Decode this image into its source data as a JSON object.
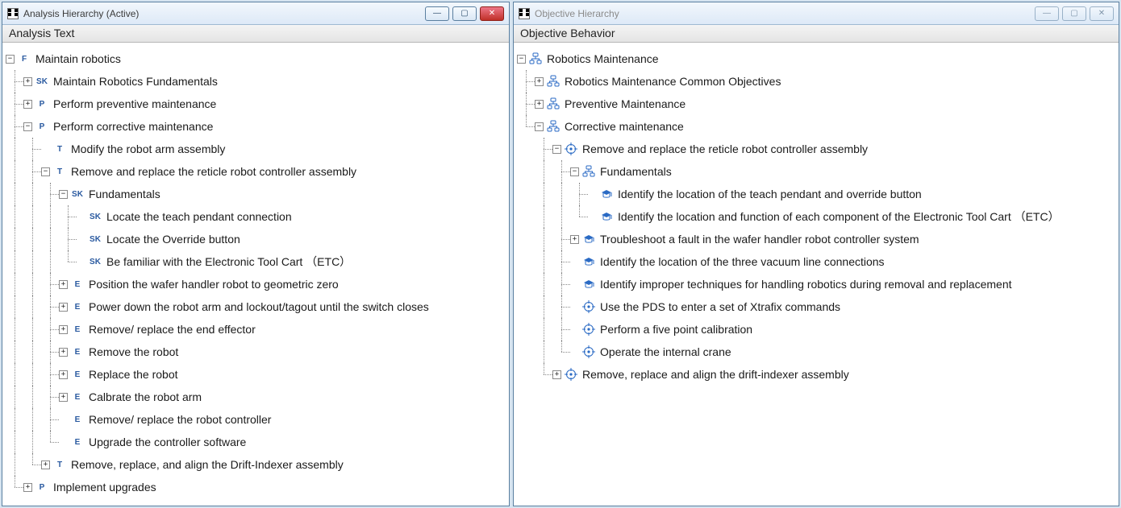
{
  "windows": {
    "analysis": {
      "title": "Analysis Hierarchy (Active)",
      "active": true,
      "heading": "Analysis Text"
    },
    "objective": {
      "title": "Objective Hierarchy",
      "active": false,
      "heading": "Objective Behavior"
    }
  },
  "win_buttons": {
    "min": "—",
    "max": "▢",
    "close": "✕"
  },
  "badges": {
    "F": "F",
    "SK": "SK",
    "P": "P",
    "T": "T",
    "E": "E"
  },
  "analysis_tree": {
    "root": {
      "badge": "F",
      "label": "Maintain robotics",
      "toggle": "minus"
    },
    "items": [
      {
        "indent": 1,
        "badge": "SK",
        "label": "Maintain Robotics Fundamentals",
        "toggle": "plus"
      },
      {
        "indent": 1,
        "badge": "P",
        "label": "Perform preventive maintenance",
        "toggle": "plus"
      },
      {
        "indent": 1,
        "badge": "P",
        "label": "Perform corrective maintenance",
        "toggle": "minus"
      },
      {
        "indent": 2,
        "badge": "T",
        "label": "Modify the robot arm assembly",
        "toggle": "none",
        "last_at": []
      },
      {
        "indent": 2,
        "badge": "T",
        "label": "Remove and replace the reticle robot controller assembly",
        "toggle": "minus"
      },
      {
        "indent": 3,
        "badge": "SK",
        "label": "Fundamentals",
        "toggle": "minus"
      },
      {
        "indent": 4,
        "badge": "SK",
        "label": "Locate the teach pendant connection",
        "toggle": "none"
      },
      {
        "indent": 4,
        "badge": "SK",
        "label": "Locate the Override button",
        "toggle": "none"
      },
      {
        "indent": 4,
        "badge": "SK",
        "label": "Be familiar with the Electronic Tool Cart （ETC）",
        "toggle": "none",
        "last": true
      },
      {
        "indent": 3,
        "badge": "E",
        "label": "Position the wafer handler robot to geometric zero",
        "toggle": "plus"
      },
      {
        "indent": 3,
        "badge": "E",
        "label": "Power down the robot arm and lockout/tagout until the switch closes",
        "toggle": "plus"
      },
      {
        "indent": 3,
        "badge": "E",
        "label": "Remove/ replace the end effector",
        "toggle": "plus"
      },
      {
        "indent": 3,
        "badge": "E",
        "label": "Remove the robot",
        "toggle": "plus"
      },
      {
        "indent": 3,
        "badge": "E",
        "label": "Replace the robot",
        "toggle": "plus"
      },
      {
        "indent": 3,
        "badge": "E",
        "label": "Calbrate the robot arm",
        "toggle": "plus"
      },
      {
        "indent": 3,
        "badge": "E",
        "label": "Remove/ replace the robot controller",
        "toggle": "none"
      },
      {
        "indent": 3,
        "badge": "E",
        "label": "Upgrade the controller software",
        "toggle": "none",
        "last": true
      },
      {
        "indent": 2,
        "badge": "T",
        "label": "Remove, replace, and align the Drift-Indexer assembly",
        "toggle": "plus",
        "last": true
      },
      {
        "indent": 1,
        "badge": "P",
        "label": "Implement upgrades",
        "toggle": "plus",
        "last": true
      }
    ]
  },
  "objective_tree": {
    "root": {
      "icon": "org",
      "label": "Robotics Maintenance",
      "toggle": "minus"
    },
    "items": [
      {
        "indent": 1,
        "icon": "org",
        "label": "Robotics Maintenance Common Objectives",
        "toggle": "plus"
      },
      {
        "indent": 1,
        "icon": "org",
        "label": "Preventive Maintenance",
        "toggle": "plus"
      },
      {
        "indent": 1,
        "icon": "org",
        "label": "Corrective maintenance",
        "toggle": "minus"
      },
      {
        "indent": 2,
        "icon": "target",
        "label": "Remove and replace the reticle robot controller assembly",
        "toggle": "minus"
      },
      {
        "indent": 3,
        "icon": "org",
        "label": "Fundamentals",
        "toggle": "minus"
      },
      {
        "indent": 4,
        "icon": "grad",
        "label": "Identify the location of the teach pendant and override button",
        "toggle": "none"
      },
      {
        "indent": 4,
        "icon": "grad",
        "label": "Identify the location and function of each component of the Electronic Tool Cart （ETC）",
        "toggle": "none",
        "last": true
      },
      {
        "indent": 3,
        "icon": "grad",
        "label": "Troubleshoot a fault in the wafer handler robot controller system",
        "toggle": "plus"
      },
      {
        "indent": 3,
        "icon": "grad",
        "label": "Identify the location of the three vacuum line connections",
        "toggle": "none"
      },
      {
        "indent": 3,
        "icon": "grad",
        "label": "Identify improper techniques for handling robotics during removal and replacement",
        "toggle": "none"
      },
      {
        "indent": 3,
        "icon": "target",
        "label": "Use the PDS to enter a set of Xtrafix commands",
        "toggle": "none"
      },
      {
        "indent": 3,
        "icon": "target",
        "label": "Perform a five point calibration",
        "toggle": "none"
      },
      {
        "indent": 3,
        "icon": "target",
        "label": "Operate the internal crane",
        "toggle": "none",
        "last": true
      },
      {
        "indent": 2,
        "icon": "target",
        "label": "Remove, replace and align the drift-indexer assembly",
        "toggle": "plus",
        "last": true
      }
    ]
  }
}
